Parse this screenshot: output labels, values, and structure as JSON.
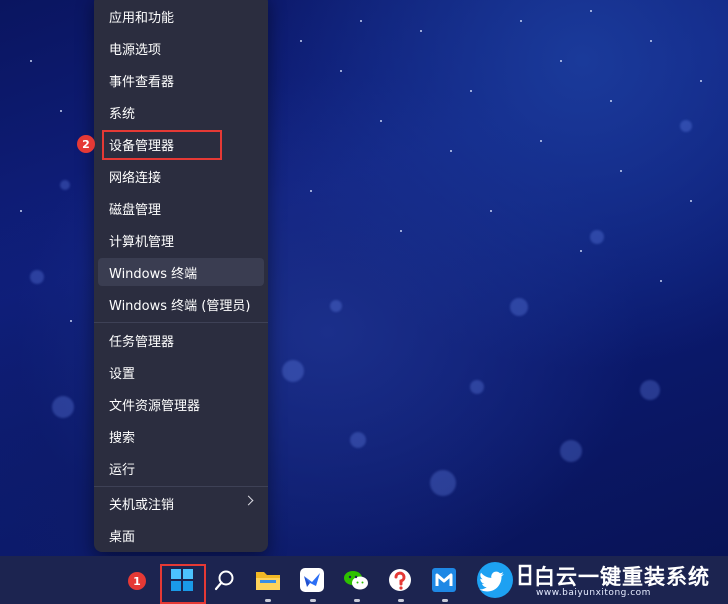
{
  "context_menu": {
    "items": [
      {
        "label": "应用和功能"
      },
      {
        "label": "电源选项"
      },
      {
        "label": "事件查看器"
      },
      {
        "label": "系统"
      },
      {
        "label": "设备管理器"
      },
      {
        "label": "网络连接"
      },
      {
        "label": "磁盘管理"
      },
      {
        "label": "计算机管理"
      },
      {
        "label": "Windows 终端"
      },
      {
        "label": "Windows 终端 (管理员)"
      },
      {
        "label": "任务管理器"
      },
      {
        "label": "设置"
      },
      {
        "label": "文件资源管理器"
      },
      {
        "label": "搜索"
      },
      {
        "label": "运行"
      },
      {
        "label": "关机或注销"
      },
      {
        "label": "桌面"
      }
    ]
  },
  "annotations": {
    "step1": "1",
    "step2": "2"
  },
  "taskbar": {
    "icons": [
      "windows-start-icon",
      "search-icon",
      "file-explorer-icon",
      "feishu-icon",
      "wechat-icon",
      "question-app-icon",
      "maxthon-icon",
      "twitter-bird-icon",
      "baiyun-logo-icon"
    ]
  },
  "watermark": {
    "title": "白云一键重装系统",
    "url": "www.baiyunxitong.com"
  },
  "colors": {
    "menu_bg": "#2b2d3f",
    "highlight_red": "#e53935",
    "taskbar_bg": "#1c2450"
  }
}
